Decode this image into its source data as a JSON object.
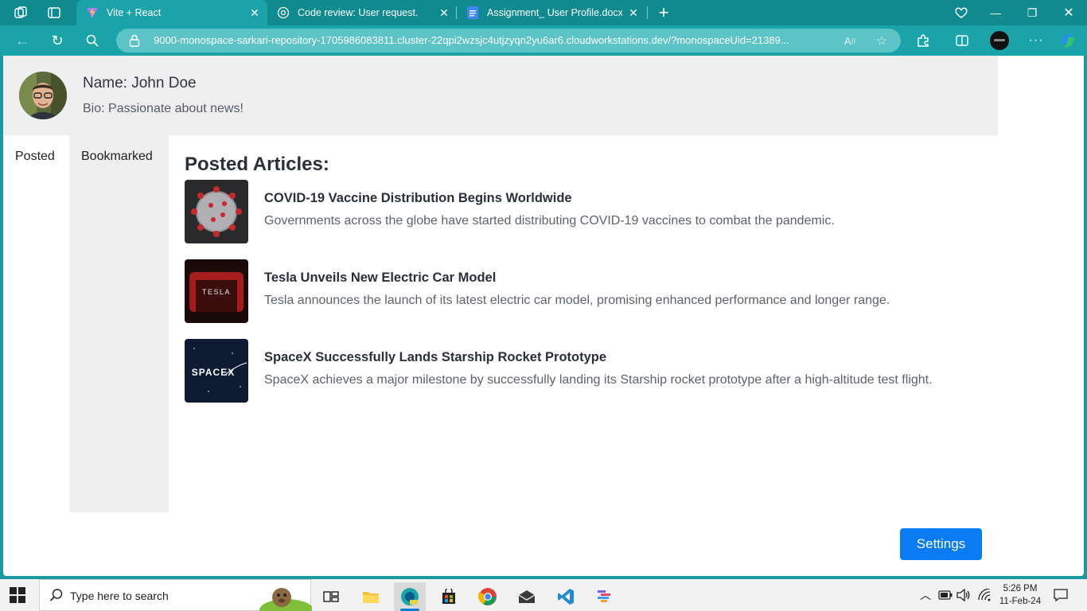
{
  "browser": {
    "tabs": [
      {
        "title": "Vite + React",
        "active": true
      },
      {
        "title": "Code review: User request.",
        "active": false
      },
      {
        "title": "Assignment_ User Profile.docx - ...",
        "active": false
      }
    ],
    "url": "9000-monospace-sarkari-repository-1705986083811.cluster-22qpi2wzsjc4utjzyqn2yu6ar6.cloudworkstations.dev/?monospaceUid=21389...",
    "icons": [
      "workspaces-icon",
      "tab-actions-icon",
      "new-tab-icon",
      "performance-icon",
      "minimize-icon",
      "restore-icon",
      "close-icon",
      "back-icon",
      "refresh-icon",
      "search-icon",
      "lock-icon",
      "read-aloud-icon",
      "favorite-icon",
      "extensions-icon",
      "split-screen-icon",
      "profile-icon",
      "more-icon",
      "copilot-icon"
    ]
  },
  "profile": {
    "name": "Name: John Doe",
    "bio": "Bio: Passionate about news!"
  },
  "tabs": {
    "posted": "Posted",
    "bookmarked": "Bookmarked"
  },
  "section_title": "Posted Articles:",
  "articles": [
    {
      "title": "COVID-19 Vaccine Distribution Begins Worldwide",
      "description": "Governments across the globe have started distributing COVID-19 vaccines to combat the pandemic.",
      "thumb_text": ""
    },
    {
      "title": "Tesla Unveils New Electric Car Model",
      "description": "Tesla announces the launch of its latest electric car model, promising enhanced performance and longer range.",
      "thumb_text": "TESLA"
    },
    {
      "title": "SpaceX Successfully Lands Starship Rocket Prototype",
      "description": "SpaceX achieves a major milestone by successfully landing its Starship rocket prototype after a high-altitude test flight.",
      "thumb_text": "SPACEX"
    }
  ],
  "settings_label": "Settings",
  "taskbar": {
    "search_placeholder": "Type here to search",
    "time": "5:26 PM",
    "date": "11-Feb-24",
    "apps": [
      "task-view-icon",
      "file-explorer-icon",
      "edge-dev-icon",
      "store-icon",
      "chrome-icon",
      "mail-icon",
      "vscode-icon",
      "jetbrains-icon"
    ]
  },
  "colors": {
    "browser_frame": "#1aa3a8",
    "settings_button": "#0a7bf0",
    "header_bg": "#efefef"
  }
}
